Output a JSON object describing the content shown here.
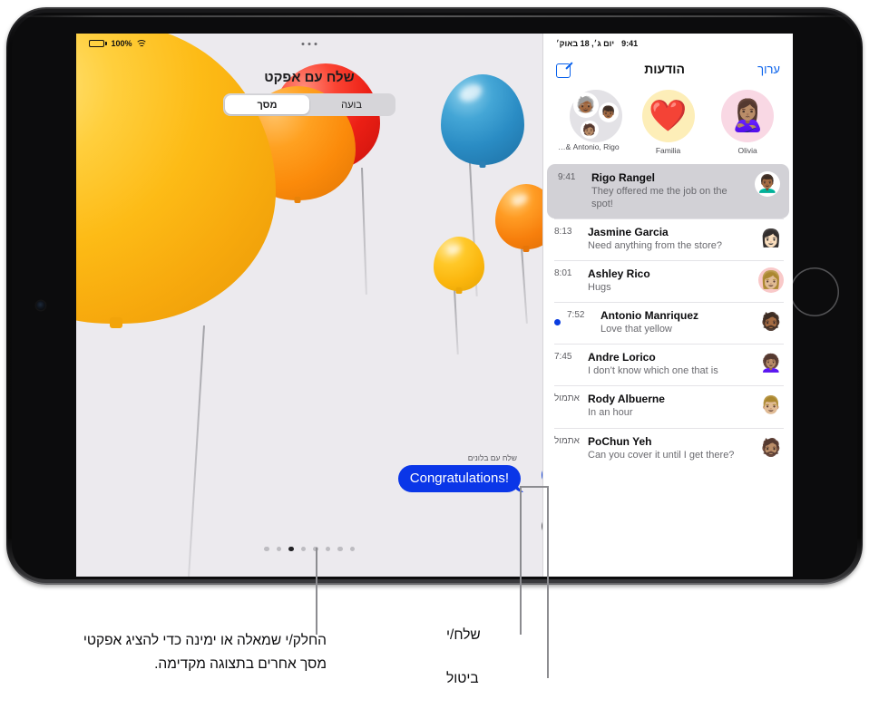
{
  "device": {
    "name": "iPad",
    "home_button": "home-button",
    "camera": "front-camera"
  },
  "status_bar_left": {
    "battery_percent": "100%",
    "battery_icon": "battery-icon",
    "wifi_icon": "wifi-icon",
    "multitask_icon": "multitasking-dots"
  },
  "status_bar_right": {
    "time": "9:41",
    "date": "יום ג׳, 18 באוק׳"
  },
  "effect_screen": {
    "title": "שלח עם אפקט",
    "segments": [
      {
        "label": "בועה",
        "active": false
      },
      {
        "label": "מסך",
        "active": true
      }
    ],
    "send_effect_label": "שלח עם בלונים",
    "bubble_text": "Congratulations!",
    "send_button": "send-arrow-up",
    "cancel_button": "cancel-x",
    "page_dots": {
      "count": 8,
      "active_index": 2
    }
  },
  "messages_pane": {
    "edit_label": "ערוך",
    "title": "הודעות",
    "compose_icon": "compose-icon",
    "pinned": [
      {
        "name": "Olivia",
        "avatar": "🙎🏽‍♀️",
        "bg": "#f9d8e4"
      },
      {
        "name": "Familia",
        "avatar": "❤️",
        "bg": "#fdeeb8"
      },
      {
        "name": "Antonio, Rigo &…",
        "avatar": "group",
        "bg": "#e3e2e6"
      }
    ],
    "conversations": [
      {
        "time": "9:41",
        "name": "Rigo Rangel",
        "preview": "They offered me the job on the spot!",
        "avatar": "👨🏾‍🦱",
        "bg": "#ffffff",
        "selected": true,
        "unread": false
      },
      {
        "time": "8:13",
        "name": "Jasmine Garcia",
        "preview": "Need anything from the store?",
        "avatar": "👩🏻",
        "bg": "#ffffff",
        "selected": false,
        "unread": false
      },
      {
        "time": "8:01",
        "name": "Ashley Rico",
        "preview": "Hugs",
        "avatar": "👩🏼",
        "bg": "#f9c9c9",
        "selected": false,
        "unread": false
      },
      {
        "time": "7:52",
        "name": "Antonio Manriquez",
        "preview": "Love that yellow",
        "avatar": "🧔🏾",
        "bg": "#ffffff",
        "selected": false,
        "unread": true
      },
      {
        "time": "7:45",
        "name": "Andre Lorico",
        "preview": "I don’t know which one that is",
        "avatar": "👩🏽‍🦱",
        "bg": "#ffffff",
        "selected": false,
        "unread": false
      },
      {
        "time": "אתמול",
        "name": "Rody Albuerne",
        "preview": "In an hour",
        "avatar": "👨🏼",
        "bg": "#ffffff",
        "selected": false,
        "unread": false
      },
      {
        "time": "אתמול",
        "name": "PoChun Yeh",
        "preview": "Can you cover it until I get there?",
        "avatar": "🧔🏽",
        "bg": "#ffffff",
        "selected": false,
        "unread": false
      }
    ]
  },
  "callouts": {
    "swipe": "החלק/י שמאלה או ימינה כדי להציג אפקטי מסך אחרים בתצוגה מקדימה.",
    "send": "שלח/י",
    "cancel": "ביטול"
  },
  "colors": {
    "accent_blue": "#0a62ec",
    "bubble_blue": "#0a36e8",
    "unread_blue": "#0a3de0",
    "selected_row": "#d2d1d6",
    "pane_bg": "#eceaee"
  }
}
